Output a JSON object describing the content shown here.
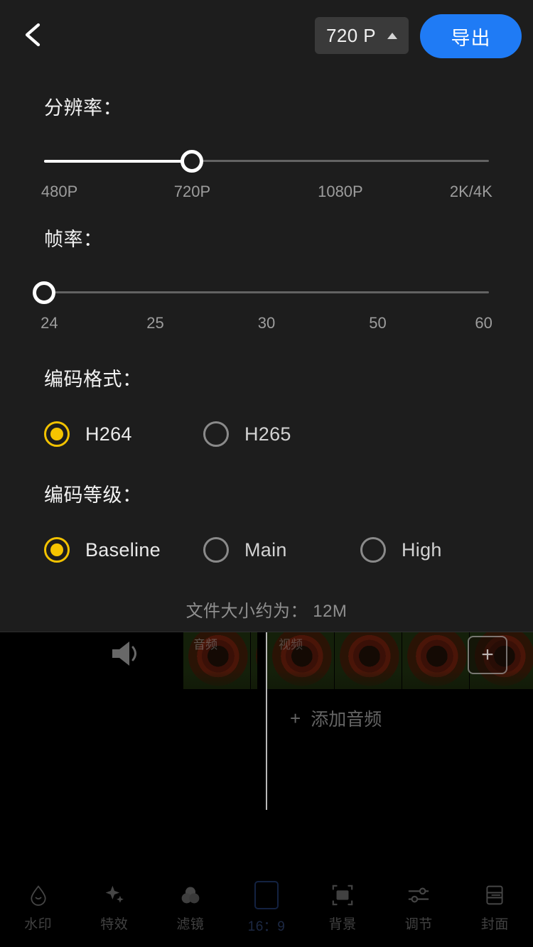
{
  "header": {
    "back_icon": "chevron-left-icon",
    "resolution_dropdown": {
      "value": "720 P",
      "caret_icon": "caret-up-icon"
    },
    "export_label": "导出"
  },
  "resolution": {
    "title": "分辨率：",
    "ticks": [
      "480P",
      "720P",
      "1080P",
      "2K/4K"
    ],
    "selected": "720P",
    "selected_index": 1
  },
  "framerate": {
    "title": "帧率：",
    "ticks": [
      "24",
      "25",
      "30",
      "50",
      "60"
    ],
    "selected": "24",
    "selected_index": 0
  },
  "encode_format": {
    "title": "编码格式：",
    "options": [
      {
        "label": "H264",
        "selected": true
      },
      {
        "label": "H265",
        "selected": false
      }
    ]
  },
  "encode_level": {
    "title": "编码等级：",
    "options": [
      {
        "label": "Baseline",
        "selected": true
      },
      {
        "label": "Main",
        "selected": false
      },
      {
        "label": "High",
        "selected": false
      }
    ]
  },
  "file_size": {
    "text": "文件大小约为： 12M"
  },
  "editor": {
    "volume_icon": "speaker-icon",
    "clip_label_primary": "音频",
    "clip_label_secondary": "视频",
    "add_clip_icon": "plus-icon",
    "add_audio": {
      "icon": "plus-icon",
      "label": "添加音频"
    }
  },
  "toolbar": {
    "items": [
      {
        "label": "水印",
        "icon": "water-drop-icon"
      },
      {
        "label": "特效",
        "icon": "sparkle-icon"
      },
      {
        "label": "滤镜",
        "icon": "filter-circles-icon"
      },
      {
        "label": "16：9",
        "icon": "aspect-ratio-icon"
      },
      {
        "label": "背景",
        "icon": "background-frame-icon"
      },
      {
        "label": "调节",
        "icon": "sliders-icon"
      },
      {
        "label": "封面",
        "icon": "cover-layout-icon"
      }
    ]
  },
  "colors": {
    "accent_blue": "#1f7bf5",
    "accent_yellow": "#f5c400",
    "panel_bg": "#1d1d1d",
    "page_bg": "#000000"
  }
}
